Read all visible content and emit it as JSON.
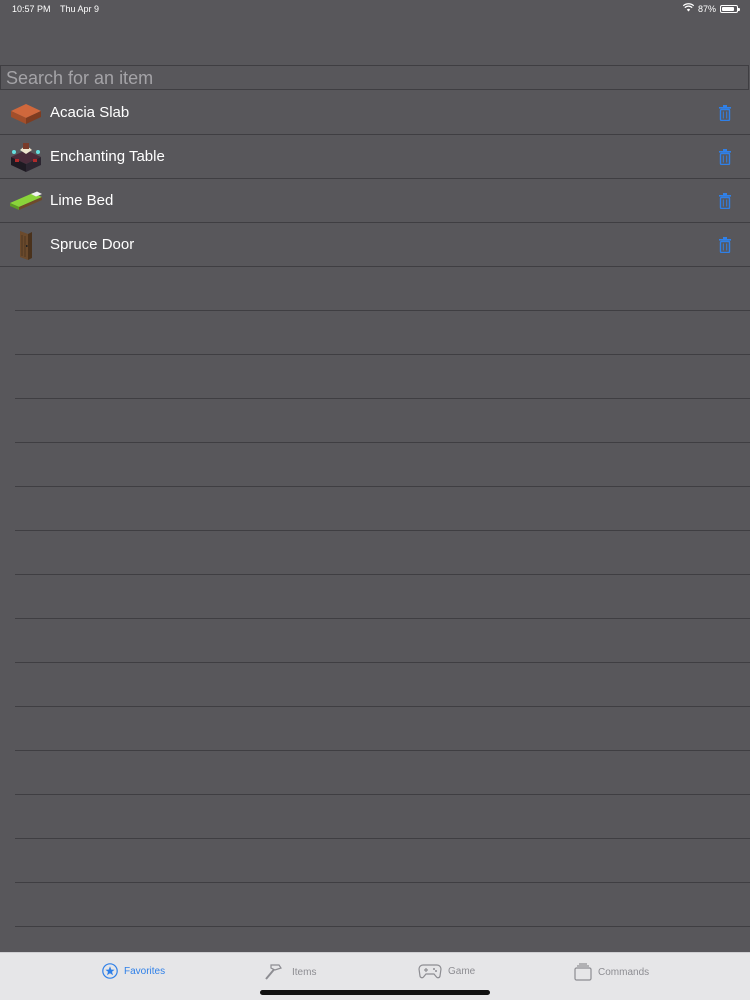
{
  "status": {
    "time": "10:57 PM",
    "date": "Thu Apr 9",
    "battery": "87%"
  },
  "search": {
    "placeholder": "Search for an item"
  },
  "favorites": [
    {
      "name": "Acacia Slab",
      "icon": "acacia-slab-icon"
    },
    {
      "name": "Enchanting Table",
      "icon": "enchanting-table-icon"
    },
    {
      "name": "Lime Bed",
      "icon": "lime-bed-icon"
    },
    {
      "name": "Spruce Door",
      "icon": "spruce-door-icon"
    }
  ],
  "tabs": [
    {
      "label": "Favorites",
      "icon": "star-icon",
      "active": true
    },
    {
      "label": "Items",
      "icon": "hammer-icon",
      "active": false
    },
    {
      "label": "Game",
      "icon": "gamepad-icon",
      "active": false
    },
    {
      "label": "Commands",
      "icon": "stack-icon",
      "active": false
    }
  ],
  "colors": {
    "background": "#58575b",
    "accent": "#2f80e8",
    "separator": "#3f3e42"
  }
}
